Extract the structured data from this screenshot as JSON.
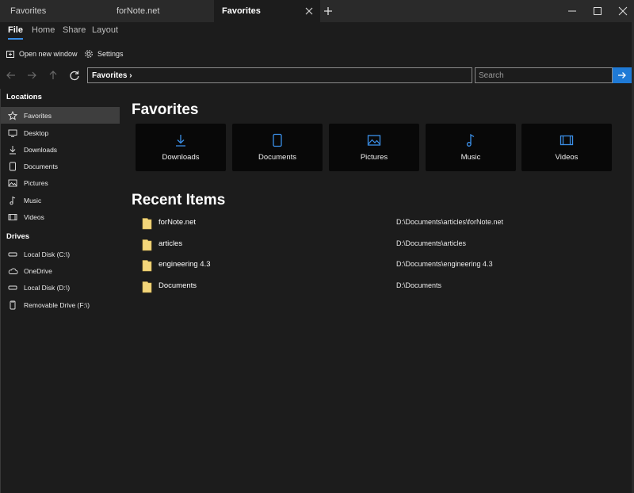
{
  "tabs": [
    {
      "label": "Favorites",
      "active": false
    },
    {
      "label": "forNote.net",
      "active": false
    },
    {
      "label": "Favorites",
      "active": true
    }
  ],
  "ribbon": {
    "tabs": [
      "File",
      "Home",
      "Share",
      "Layout"
    ],
    "active_tab": "File"
  },
  "commands": {
    "open_new_window": "Open new window",
    "settings": "Settings"
  },
  "navigation": {
    "address": "Favorites ›",
    "search_placeholder": "Search"
  },
  "sidebar": {
    "locations_title": "Locations",
    "locations": [
      {
        "label": "Favorites",
        "icon": "star-icon",
        "selected": true
      },
      {
        "label": "Desktop",
        "icon": "desktop-icon"
      },
      {
        "label": "Downloads",
        "icon": "download-icon"
      },
      {
        "label": "Documents",
        "icon": "document-icon"
      },
      {
        "label": "Pictures",
        "icon": "picture-icon"
      },
      {
        "label": "Music",
        "icon": "music-icon"
      },
      {
        "label": "Videos",
        "icon": "video-icon"
      }
    ],
    "drives_title": "Drives",
    "drives": [
      {
        "label": "Local Disk (C:\\)",
        "icon": "drive-icon"
      },
      {
        "label": "OneDrive",
        "icon": "cloud-icon"
      },
      {
        "label": "Local Disk (D:\\)",
        "icon": "drive-icon"
      },
      {
        "label": "Removable Drive (F:\\)",
        "icon": "usb-drive-icon"
      }
    ]
  },
  "main": {
    "favorites_title": "Favorites",
    "favorites": [
      {
        "label": "Downloads",
        "icon": "download-icon"
      },
      {
        "label": "Documents",
        "icon": "document-icon"
      },
      {
        "label": "Pictures",
        "icon": "picture-icon"
      },
      {
        "label": "Music",
        "icon": "music-icon"
      },
      {
        "label": "Videos",
        "icon": "video-icon"
      }
    ],
    "recent_title": "Recent Items",
    "recent": [
      {
        "name": "forNote.net",
        "path": "D:\\Documents\\articles\\forNote.net"
      },
      {
        "name": "articles",
        "path": "D:\\Documents\\articles"
      },
      {
        "name": "engineering 4.3",
        "path": "D:\\Documents\\engineering 4.3"
      },
      {
        "name": "Documents",
        "path": "D:\\Documents"
      }
    ]
  },
  "colors": {
    "accent": "#3a8ee6",
    "icon_blue": "#3b8fe8",
    "folder_yellow": "#f3d67a",
    "background": "#1c1c1c",
    "tile": "#080808"
  }
}
